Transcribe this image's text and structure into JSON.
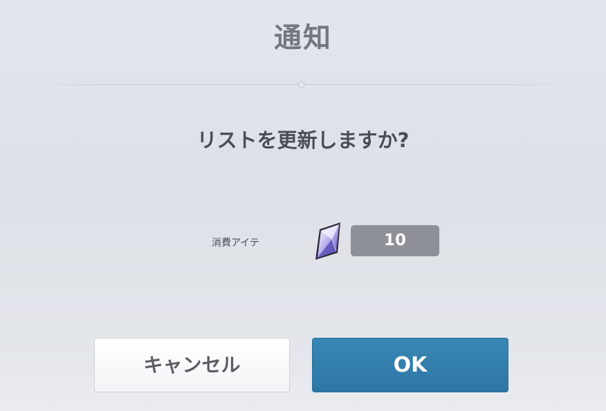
{
  "dialog": {
    "title": "通知",
    "message": "リストを更新しますか?",
    "cost": {
      "label": "消費アイテ",
      "icon": "crystal-icon",
      "amount": "10"
    },
    "buttons": {
      "cancel_label": "キャンセル",
      "ok_label": "OK"
    }
  },
  "colors": {
    "ok_button": "#3180ad",
    "cost_box": "#8d9096",
    "title_text": "#737880"
  }
}
